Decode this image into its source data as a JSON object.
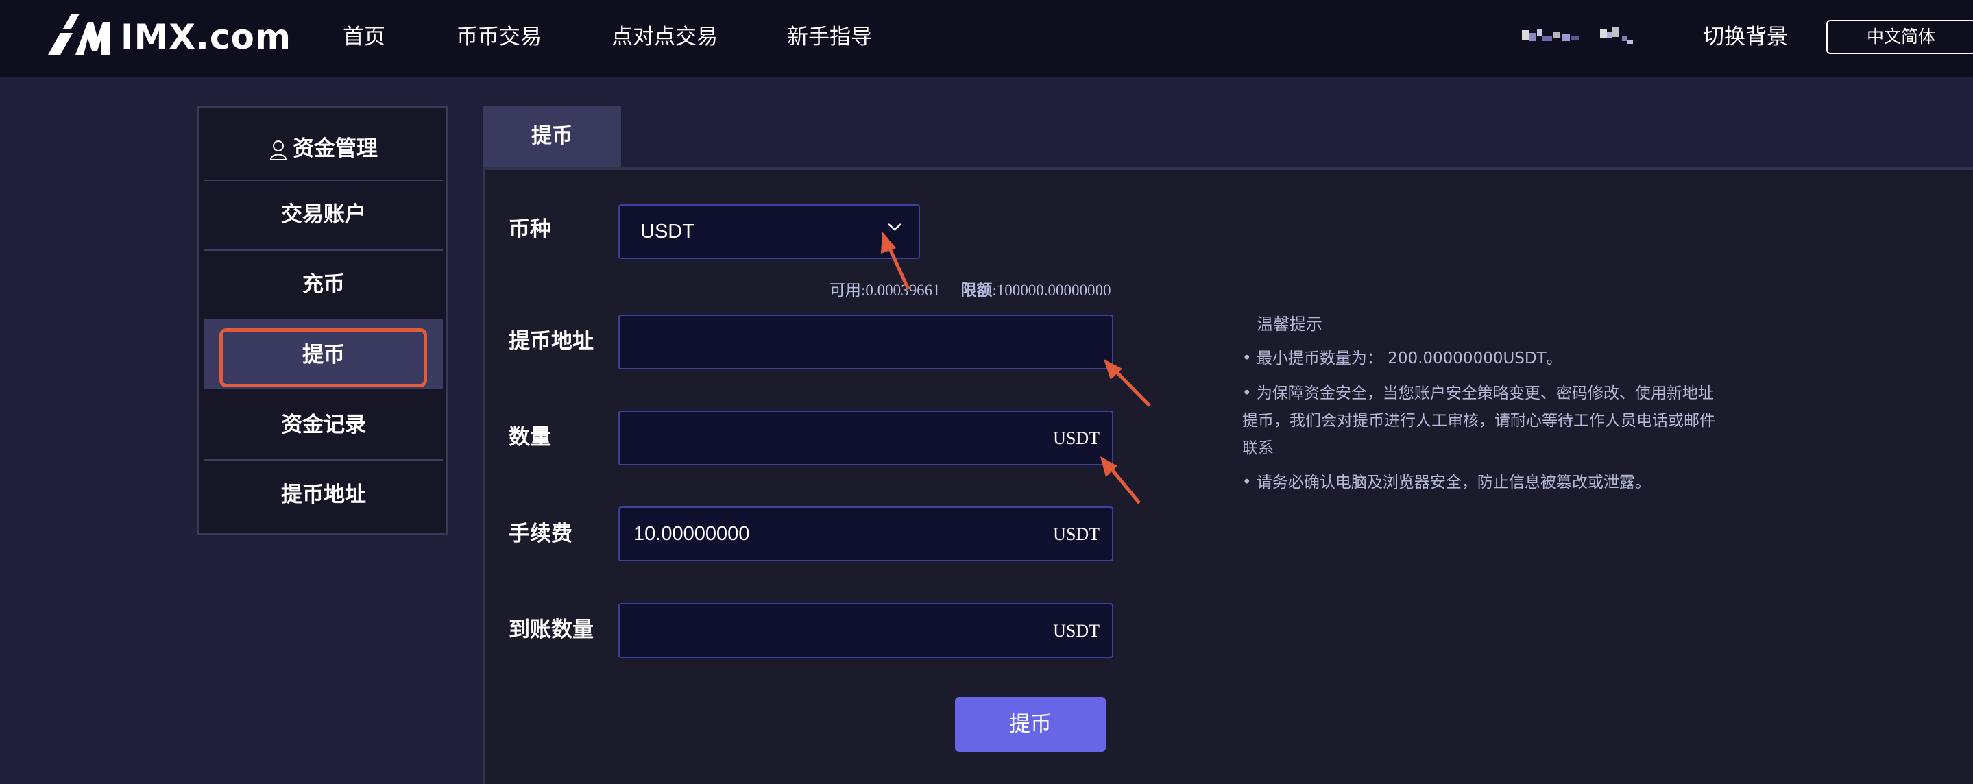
{
  "header": {
    "logo_text": "IMX.com",
    "nav": [
      "首页",
      "币币交易",
      "点对点交易",
      "新手指导"
    ],
    "switch_bg": "切换背景",
    "lang": "中文简体"
  },
  "sidebar": {
    "items": [
      {
        "label": "资金管理",
        "icon": "user-icon"
      },
      {
        "label": "交易账户"
      },
      {
        "label": "充币"
      },
      {
        "label": "提币",
        "active": true
      },
      {
        "label": "资金记录"
      },
      {
        "label": "提币地址"
      }
    ]
  },
  "tab": {
    "label": "提币"
  },
  "form": {
    "coin_label": "币种",
    "coin_value": "USDT",
    "available": "可用:0.00039661",
    "limit_label": "限额",
    "limit_value": ":100000.00000000",
    "address_label": "提币地址",
    "address_value": "",
    "amount_label": "数量",
    "amount_value": "",
    "fee_label": "手续费",
    "fee_value": "10.00000000",
    "received_label": "到账数量",
    "received_value": "",
    "unit": "USDT",
    "submit": "提币"
  },
  "tips": {
    "title": "温馨提示",
    "items": [
      "• 最小提币数量为： 200.00000000USDT。",
      "• 为保障资金安全，当您账户安全策略变更、密码修改、使用新地址提币，我们会对提币进行人工审核，请耐心等待工作人员电话或邮件联系",
      "• 请务必确认电脑及浏览器安全，防止信息被篡改或泄露。"
    ]
  },
  "colors": {
    "background": "#20203a",
    "header": "#0e0e1e",
    "input_border": "#3e40a0",
    "button": "#6666e6",
    "annotation": "#e25b3a"
  }
}
